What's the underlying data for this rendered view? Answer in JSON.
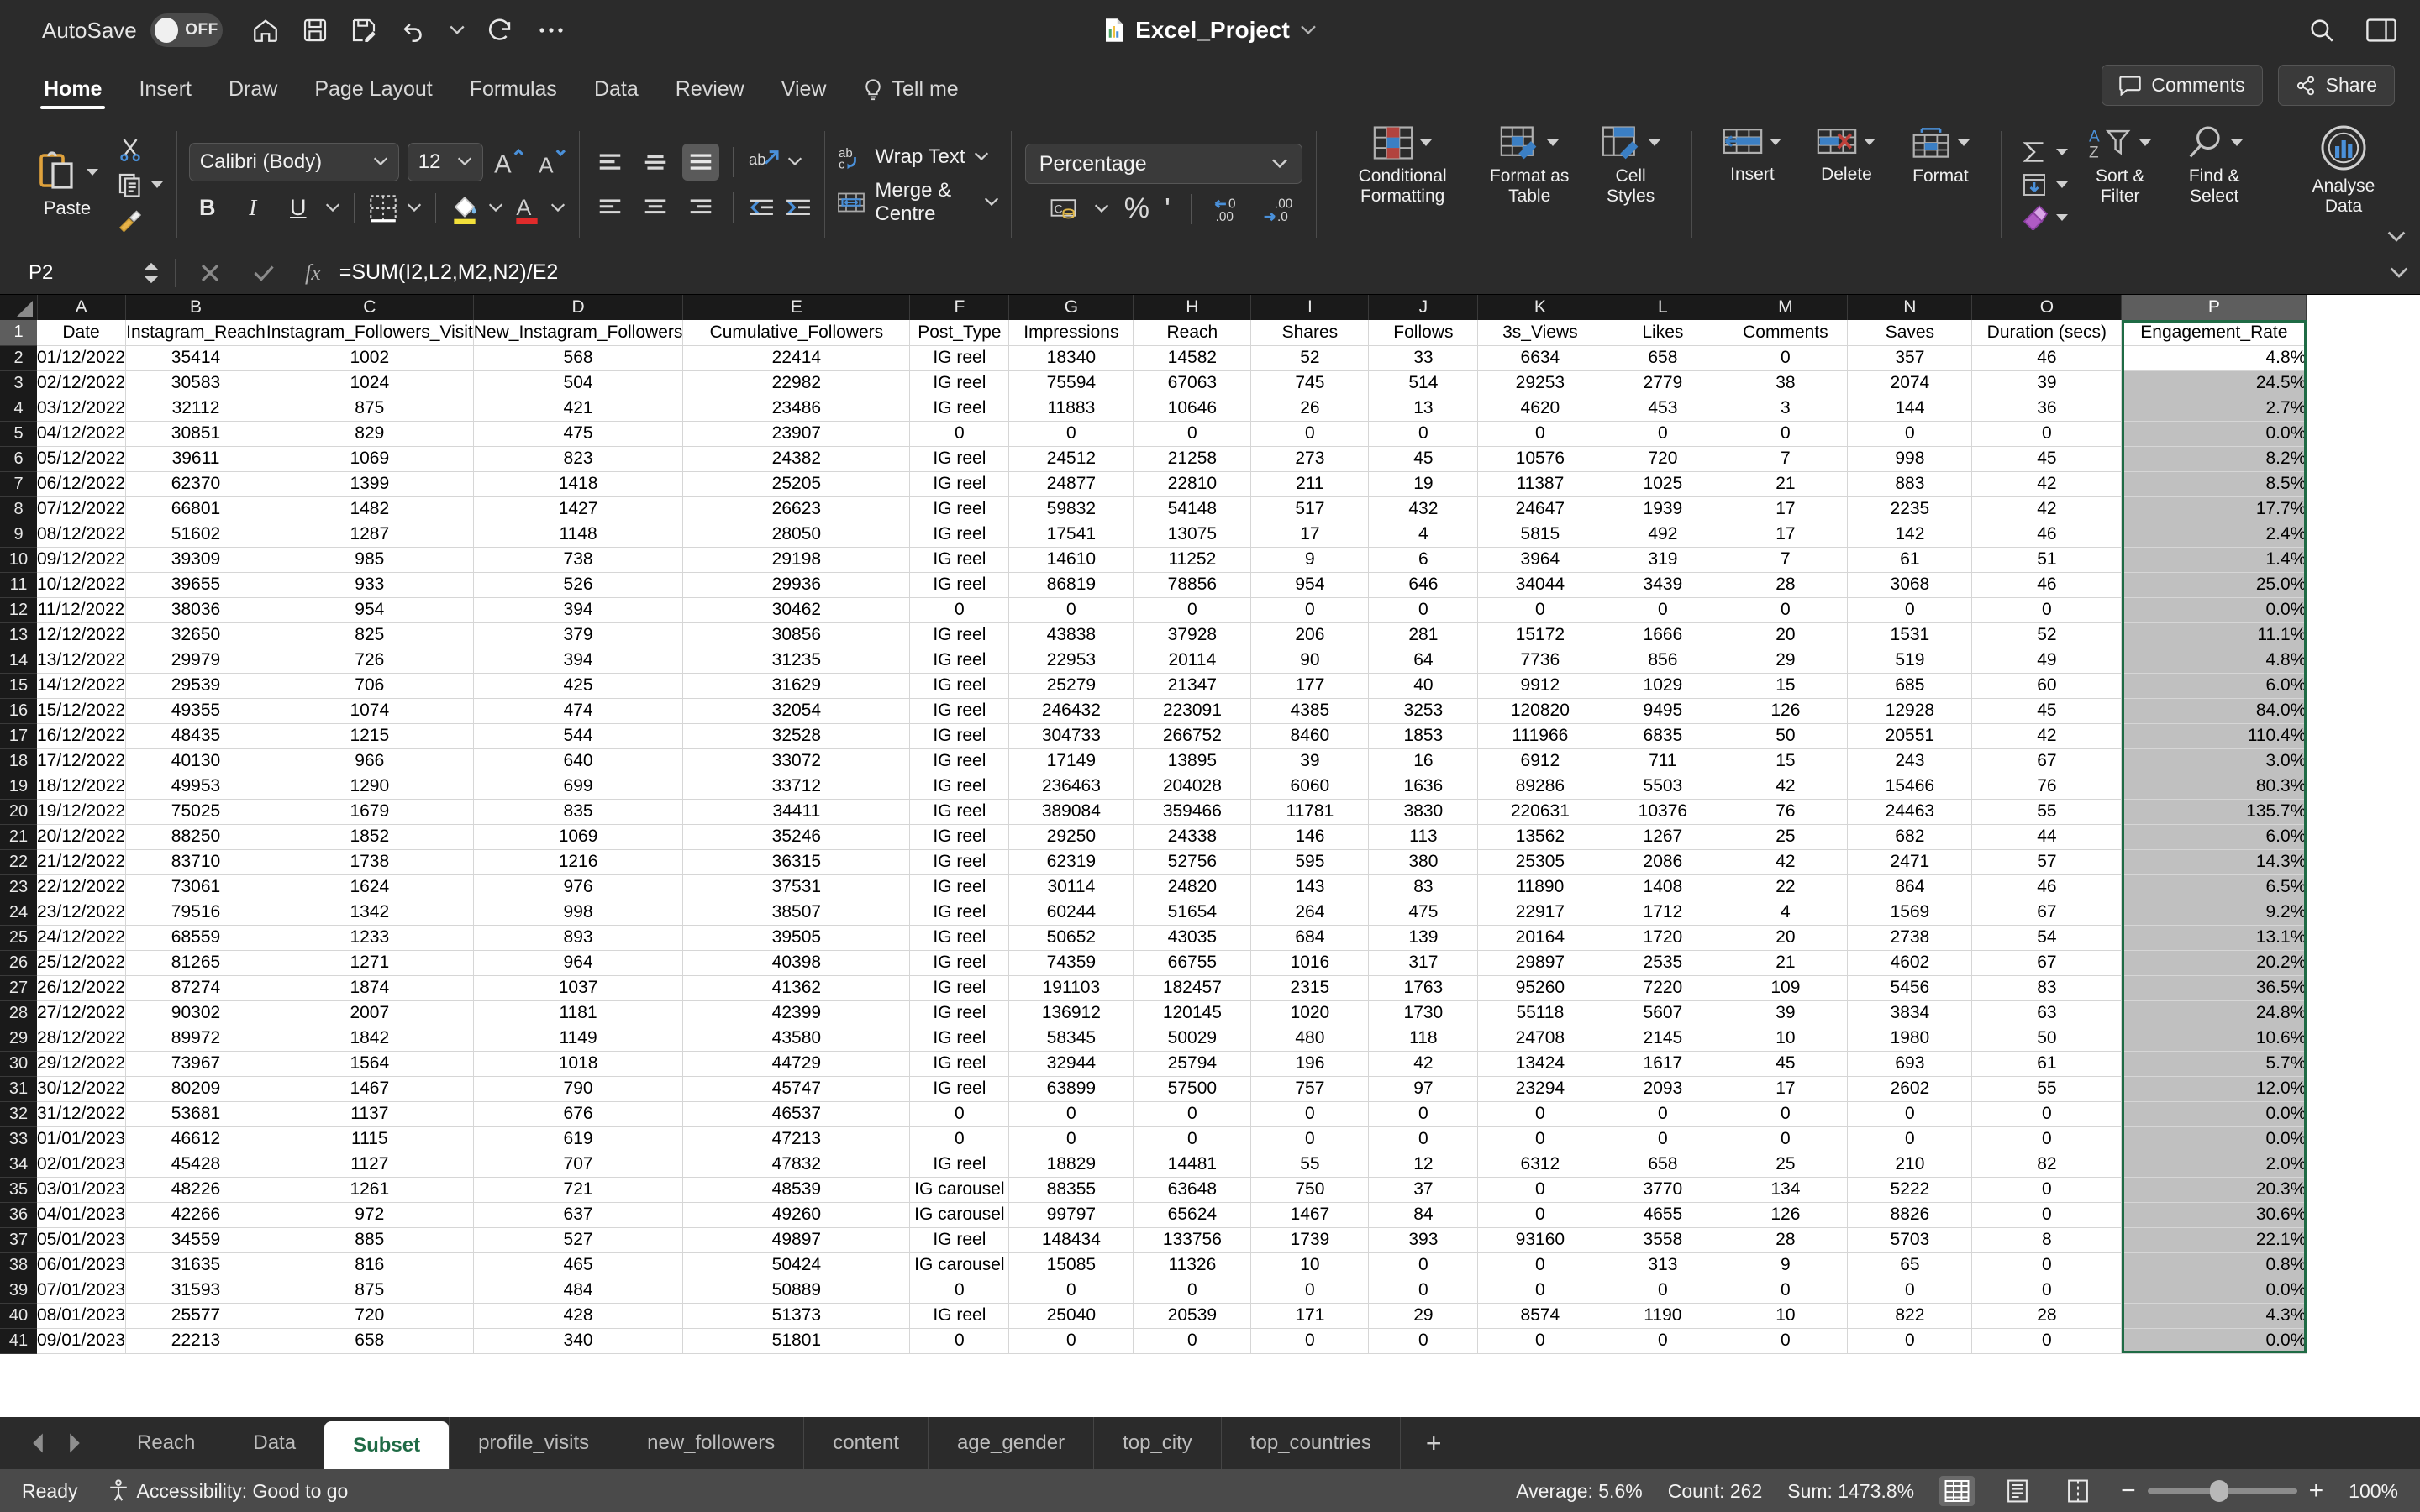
{
  "titlebar": {
    "autosave_label": "AutoSave",
    "autosave_state": "OFF",
    "doc_title": "Excel_Project",
    "icons": [
      "home-icon",
      "save-icon",
      "save-as-icon",
      "undo-icon",
      "redo-icon",
      "more-icon",
      "search-icon",
      "sidebar-icon"
    ]
  },
  "ribbon_tabs": {
    "tabs": [
      "Home",
      "Insert",
      "Draw",
      "Page Layout",
      "Formulas",
      "Data",
      "Review",
      "View"
    ],
    "active": "Home",
    "tell_me": "Tell me",
    "comments": "Comments",
    "share": "Share"
  },
  "ribbon": {
    "paste_label": "Paste",
    "font_name": "Calibri (Body)",
    "font_size": "12",
    "bold": "B",
    "italic": "I",
    "underline": "U",
    "wrap_text": "Wrap Text",
    "merge_centre": "Merge & Centre",
    "number_format": "Percentage",
    "conditional_formatting": "Conditional Formatting",
    "format_as_table": "Format as Table",
    "cell_styles": "Cell Styles",
    "insert": "Insert",
    "delete": "Delete",
    "format": "Format",
    "sort_filter": "Sort & Filter",
    "find_select": "Find & Select",
    "analyse_data": "Analyse Data"
  },
  "formula_bar": {
    "name_box": "P2",
    "formula": "=SUM(I2,L2,M2,N2)/E2",
    "cancel_icon": "cancel-icon",
    "confirm_icon": "confirm-icon",
    "fx_icon": "fx-icon"
  },
  "grid": {
    "column_letters": [
      "A",
      "B",
      "C",
      "D",
      "E",
      "F",
      "G",
      "H",
      "I",
      "J",
      "K",
      "L",
      "M",
      "N",
      "O",
      "P"
    ],
    "selected_column": "P",
    "selected_cell": "P2",
    "headers": [
      "Date",
      "Instagram_Reach",
      "Instagram_Followers_Visit",
      "New_Instagram_Followers",
      "Cumulative_Followers",
      "Post_Type",
      "Impressions",
      "Reach",
      "Shares",
      "Follows",
      "3s_Views",
      "Likes",
      "Comments",
      "Saves",
      "Duration (secs)",
      "Engagement_Rate"
    ],
    "first_row_number": 1,
    "rows": [
      [
        "01/12/2022",
        "35414",
        "1002",
        "568",
        "22414",
        "IG reel",
        "18340",
        "14582",
        "52",
        "33",
        "6634",
        "658",
        "0",
        "357",
        "46",
        "4.8%"
      ],
      [
        "02/12/2022",
        "30583",
        "1024",
        "504",
        "22982",
        "IG reel",
        "75594",
        "67063",
        "745",
        "514",
        "29253",
        "2779",
        "38",
        "2074",
        "39",
        "24.5%"
      ],
      [
        "03/12/2022",
        "32112",
        "875",
        "421",
        "23486",
        "IG reel",
        "11883",
        "10646",
        "26",
        "13",
        "4620",
        "453",
        "3",
        "144",
        "36",
        "2.7%"
      ],
      [
        "04/12/2022",
        "30851",
        "829",
        "475",
        "23907",
        "0",
        "0",
        "0",
        "0",
        "0",
        "0",
        "0",
        "0",
        "0",
        "0",
        "0.0%"
      ],
      [
        "05/12/2022",
        "39611",
        "1069",
        "823",
        "24382",
        "IG reel",
        "24512",
        "21258",
        "273",
        "45",
        "10576",
        "720",
        "7",
        "998",
        "45",
        "8.2%"
      ],
      [
        "06/12/2022",
        "62370",
        "1399",
        "1418",
        "25205",
        "IG reel",
        "24877",
        "22810",
        "211",
        "19",
        "11387",
        "1025",
        "21",
        "883",
        "42",
        "8.5%"
      ],
      [
        "07/12/2022",
        "66801",
        "1482",
        "1427",
        "26623",
        "IG reel",
        "59832",
        "54148",
        "517",
        "432",
        "24647",
        "1939",
        "17",
        "2235",
        "42",
        "17.7%"
      ],
      [
        "08/12/2022",
        "51602",
        "1287",
        "1148",
        "28050",
        "IG reel",
        "17541",
        "13075",
        "17",
        "4",
        "5815",
        "492",
        "17",
        "142",
        "46",
        "2.4%"
      ],
      [
        "09/12/2022",
        "39309",
        "985",
        "738",
        "29198",
        "IG reel",
        "14610",
        "11252",
        "9",
        "6",
        "3964",
        "319",
        "7",
        "61",
        "51",
        "1.4%"
      ],
      [
        "10/12/2022",
        "39655",
        "933",
        "526",
        "29936",
        "IG reel",
        "86819",
        "78856",
        "954",
        "646",
        "34044",
        "3439",
        "28",
        "3068",
        "46",
        "25.0%"
      ],
      [
        "11/12/2022",
        "38036",
        "954",
        "394",
        "30462",
        "0",
        "0",
        "0",
        "0",
        "0",
        "0",
        "0",
        "0",
        "0",
        "0",
        "0.0%"
      ],
      [
        "12/12/2022",
        "32650",
        "825",
        "379",
        "30856",
        "IG reel",
        "43838",
        "37928",
        "206",
        "281",
        "15172",
        "1666",
        "20",
        "1531",
        "52",
        "11.1%"
      ],
      [
        "13/12/2022",
        "29979",
        "726",
        "394",
        "31235",
        "IG reel",
        "22953",
        "20114",
        "90",
        "64",
        "7736",
        "856",
        "29",
        "519",
        "49",
        "4.8%"
      ],
      [
        "14/12/2022",
        "29539",
        "706",
        "425",
        "31629",
        "IG reel",
        "25279",
        "21347",
        "177",
        "40",
        "9912",
        "1029",
        "15",
        "685",
        "60",
        "6.0%"
      ],
      [
        "15/12/2022",
        "49355",
        "1074",
        "474",
        "32054",
        "IG reel",
        "246432",
        "223091",
        "4385",
        "3253",
        "120820",
        "9495",
        "126",
        "12928",
        "45",
        "84.0%"
      ],
      [
        "16/12/2022",
        "48435",
        "1215",
        "544",
        "32528",
        "IG reel",
        "304733",
        "266752",
        "8460",
        "1853",
        "111966",
        "6835",
        "50",
        "20551",
        "42",
        "110.4%"
      ],
      [
        "17/12/2022",
        "40130",
        "966",
        "640",
        "33072",
        "IG reel",
        "17149",
        "13895",
        "39",
        "16",
        "6912",
        "711",
        "15",
        "243",
        "67",
        "3.0%"
      ],
      [
        "18/12/2022",
        "49953",
        "1290",
        "699",
        "33712",
        "IG reel",
        "236463",
        "204028",
        "6060",
        "1636",
        "89286",
        "5503",
        "42",
        "15466",
        "76",
        "80.3%"
      ],
      [
        "19/12/2022",
        "75025",
        "1679",
        "835",
        "34411",
        "IG reel",
        "389084",
        "359466",
        "11781",
        "3830",
        "220631",
        "10376",
        "76",
        "24463",
        "55",
        "135.7%"
      ],
      [
        "20/12/2022",
        "88250",
        "1852",
        "1069",
        "35246",
        "IG reel",
        "29250",
        "24338",
        "146",
        "113",
        "13562",
        "1267",
        "25",
        "682",
        "44",
        "6.0%"
      ],
      [
        "21/12/2022",
        "83710",
        "1738",
        "1216",
        "36315",
        "IG reel",
        "62319",
        "52756",
        "595",
        "380",
        "25305",
        "2086",
        "42",
        "2471",
        "57",
        "14.3%"
      ],
      [
        "22/12/2022",
        "73061",
        "1624",
        "976",
        "37531",
        "IG reel",
        "30114",
        "24820",
        "143",
        "83",
        "11890",
        "1408",
        "22",
        "864",
        "46",
        "6.5%"
      ],
      [
        "23/12/2022",
        "79516",
        "1342",
        "998",
        "38507",
        "IG reel",
        "60244",
        "51654",
        "264",
        "475",
        "22917",
        "1712",
        "4",
        "1569",
        "67",
        "9.2%"
      ],
      [
        "24/12/2022",
        "68559",
        "1233",
        "893",
        "39505",
        "IG reel",
        "50652",
        "43035",
        "684",
        "139",
        "20164",
        "1720",
        "20",
        "2738",
        "54",
        "13.1%"
      ],
      [
        "25/12/2022",
        "81265",
        "1271",
        "964",
        "40398",
        "IG reel",
        "74359",
        "66755",
        "1016",
        "317",
        "29897",
        "2535",
        "21",
        "4602",
        "67",
        "20.2%"
      ],
      [
        "26/12/2022",
        "87274",
        "1874",
        "1037",
        "41362",
        "IG reel",
        "191103",
        "182457",
        "2315",
        "1763",
        "95260",
        "7220",
        "109",
        "5456",
        "83",
        "36.5%"
      ],
      [
        "27/12/2022",
        "90302",
        "2007",
        "1181",
        "42399",
        "IG reel",
        "136912",
        "120145",
        "1020",
        "1730",
        "55118",
        "5607",
        "39",
        "3834",
        "63",
        "24.8%"
      ],
      [
        "28/12/2022",
        "89972",
        "1842",
        "1149",
        "43580",
        "IG reel",
        "58345",
        "50029",
        "480",
        "118",
        "24708",
        "2145",
        "10",
        "1980",
        "50",
        "10.6%"
      ],
      [
        "29/12/2022",
        "73967",
        "1564",
        "1018",
        "44729",
        "IG reel",
        "32944",
        "25794",
        "196",
        "42",
        "13424",
        "1617",
        "45",
        "693",
        "61",
        "5.7%"
      ],
      [
        "30/12/2022",
        "80209",
        "1467",
        "790",
        "45747",
        "IG reel",
        "63899",
        "57500",
        "757",
        "97",
        "23294",
        "2093",
        "17",
        "2602",
        "55",
        "12.0%"
      ],
      [
        "31/12/2022",
        "53681",
        "1137",
        "676",
        "46537",
        "0",
        "0",
        "0",
        "0",
        "0",
        "0",
        "0",
        "0",
        "0",
        "0",
        "0.0%"
      ],
      [
        "01/01/2023",
        "46612",
        "1115",
        "619",
        "47213",
        "0",
        "0",
        "0",
        "0",
        "0",
        "0",
        "0",
        "0",
        "0",
        "0",
        "0.0%"
      ],
      [
        "02/01/2023",
        "45428",
        "1127",
        "707",
        "47832",
        "IG reel",
        "18829",
        "14481",
        "55",
        "12",
        "6312",
        "658",
        "25",
        "210",
        "82",
        "2.0%"
      ],
      [
        "03/01/2023",
        "48226",
        "1261",
        "721",
        "48539",
        "IG carousel",
        "88355",
        "63648",
        "750",
        "37",
        "0",
        "3770",
        "134",
        "5222",
        "0",
        "20.3%"
      ],
      [
        "04/01/2023",
        "42266",
        "972",
        "637",
        "49260",
        "IG carousel",
        "99797",
        "65624",
        "1467",
        "84",
        "0",
        "4655",
        "126",
        "8826",
        "0",
        "30.6%"
      ],
      [
        "05/01/2023",
        "34559",
        "885",
        "527",
        "49897",
        "IG reel",
        "148434",
        "133756",
        "1739",
        "393",
        "93160",
        "3558",
        "28",
        "5703",
        "8",
        "22.1%"
      ],
      [
        "06/01/2023",
        "31635",
        "816",
        "465",
        "50424",
        "IG carousel",
        "15085",
        "11326",
        "10",
        "0",
        "0",
        "313",
        "9",
        "65",
        "0",
        "0.8%"
      ],
      [
        "07/01/2023",
        "31593",
        "875",
        "484",
        "50889",
        "0",
        "0",
        "0",
        "0",
        "0",
        "0",
        "0",
        "0",
        "0",
        "0",
        "0.0%"
      ],
      [
        "08/01/2023",
        "25577",
        "720",
        "428",
        "51373",
        "IG reel",
        "25040",
        "20539",
        "171",
        "29",
        "8574",
        "1190",
        "10",
        "822",
        "28",
        "4.3%"
      ],
      [
        "09/01/2023",
        "22213",
        "658",
        "340",
        "51801",
        "0",
        "0",
        "0",
        "0",
        "0",
        "0",
        "0",
        "0",
        "0",
        "0",
        "0.0%"
      ]
    ]
  },
  "sheet_tabs": {
    "tabs": [
      "Reach",
      "Data",
      "Subset",
      "profile_visits",
      "new_followers",
      "content",
      "age_gender",
      "top_city",
      "top_countries"
    ],
    "active": "Subset",
    "add_label": "+"
  },
  "status_bar": {
    "state": "Ready",
    "accessibility": "Accessibility: Good to go",
    "average": "Average: 5.6%",
    "count": "Count: 262",
    "sum": "Sum: 1473.8%",
    "zoom": "100%",
    "zoom_out": "−",
    "zoom_in": "+"
  },
  "colors": {
    "accent_green": "#1f6b45",
    "ribbon_bg": "#2b2b2b",
    "status_bg": "#4a4a4a",
    "selection_fill": "#c0c0c0"
  }
}
